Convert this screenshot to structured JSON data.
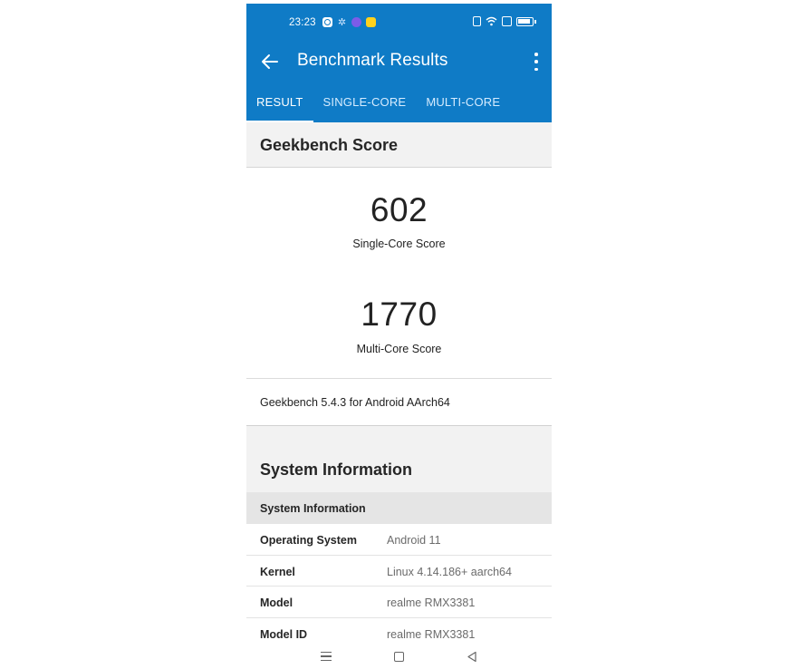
{
  "status_bar": {
    "time": "23:23"
  },
  "toolbar": {
    "title": "Benchmark Results"
  },
  "tabs": [
    {
      "label": "RESULT",
      "active": true
    },
    {
      "label": "SINGLE-CORE",
      "active": false
    },
    {
      "label": "MULTI-CORE",
      "active": false
    }
  ],
  "geekbench_score": {
    "heading": "Geekbench Score",
    "single_core": {
      "value": "602",
      "label": "Single-Core Score"
    },
    "multi_core": {
      "value": "1770",
      "label": "Multi-Core Score"
    },
    "version": "Geekbench 5.4.3 for Android AArch64"
  },
  "system_information": {
    "heading": "System Information",
    "subheading": "System Information",
    "rows": [
      {
        "key": "Operating System",
        "value": "Android 11"
      },
      {
        "key": "Kernel",
        "value": "Linux 4.14.186+ aarch64"
      },
      {
        "key": "Model",
        "value": "realme RMX3381"
      },
      {
        "key": "Model ID",
        "value": "realme RMX3381"
      }
    ]
  },
  "colors": {
    "accent": "#0f7bc6"
  }
}
